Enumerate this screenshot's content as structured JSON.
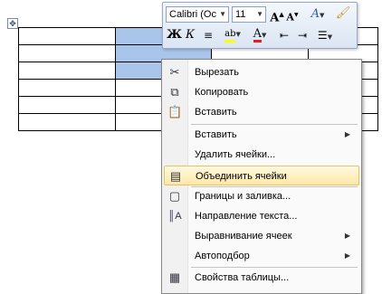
{
  "table": {
    "rows": 6,
    "cols": 4,
    "selected": [
      [
        0,
        1
      ],
      [
        1,
        1
      ],
      [
        2,
        1
      ]
    ]
  },
  "mini_toolbar": {
    "font_name": "Calibri (Ос",
    "font_size": "11",
    "grow_font": "A",
    "shrink_font": "A",
    "styles": "A",
    "bold": "Ж",
    "italic": "К",
    "highlight_label": "ab",
    "highlight_color": "#ffff00",
    "font_color_letter": "A",
    "font_color": "#e02020"
  },
  "menu": {
    "items": [
      {
        "label": "Вырезать",
        "icon": "scissors-icon"
      },
      {
        "label": "Копировать",
        "icon": "copy-icon"
      },
      {
        "label": "Вставить",
        "icon": "paste-icon"
      },
      {
        "label": "Вставить",
        "icon": "",
        "submenu": true
      },
      {
        "label": "Удалить ячейки...",
        "icon": ""
      },
      {
        "label": "Объединить ячейки",
        "icon": "merge-cells-icon",
        "highlighted": true
      },
      {
        "label": "Границы и заливка...",
        "icon": "borders-icon"
      },
      {
        "label": "Направление текста...",
        "icon": "text-direction-icon"
      },
      {
        "label": "Выравнивание ячеек",
        "icon": "",
        "submenu": true
      },
      {
        "label": "Автоподбор",
        "icon": "",
        "submenu": true
      },
      {
        "label": "Свойства таблицы...",
        "icon": "table-properties-icon"
      }
    ]
  }
}
